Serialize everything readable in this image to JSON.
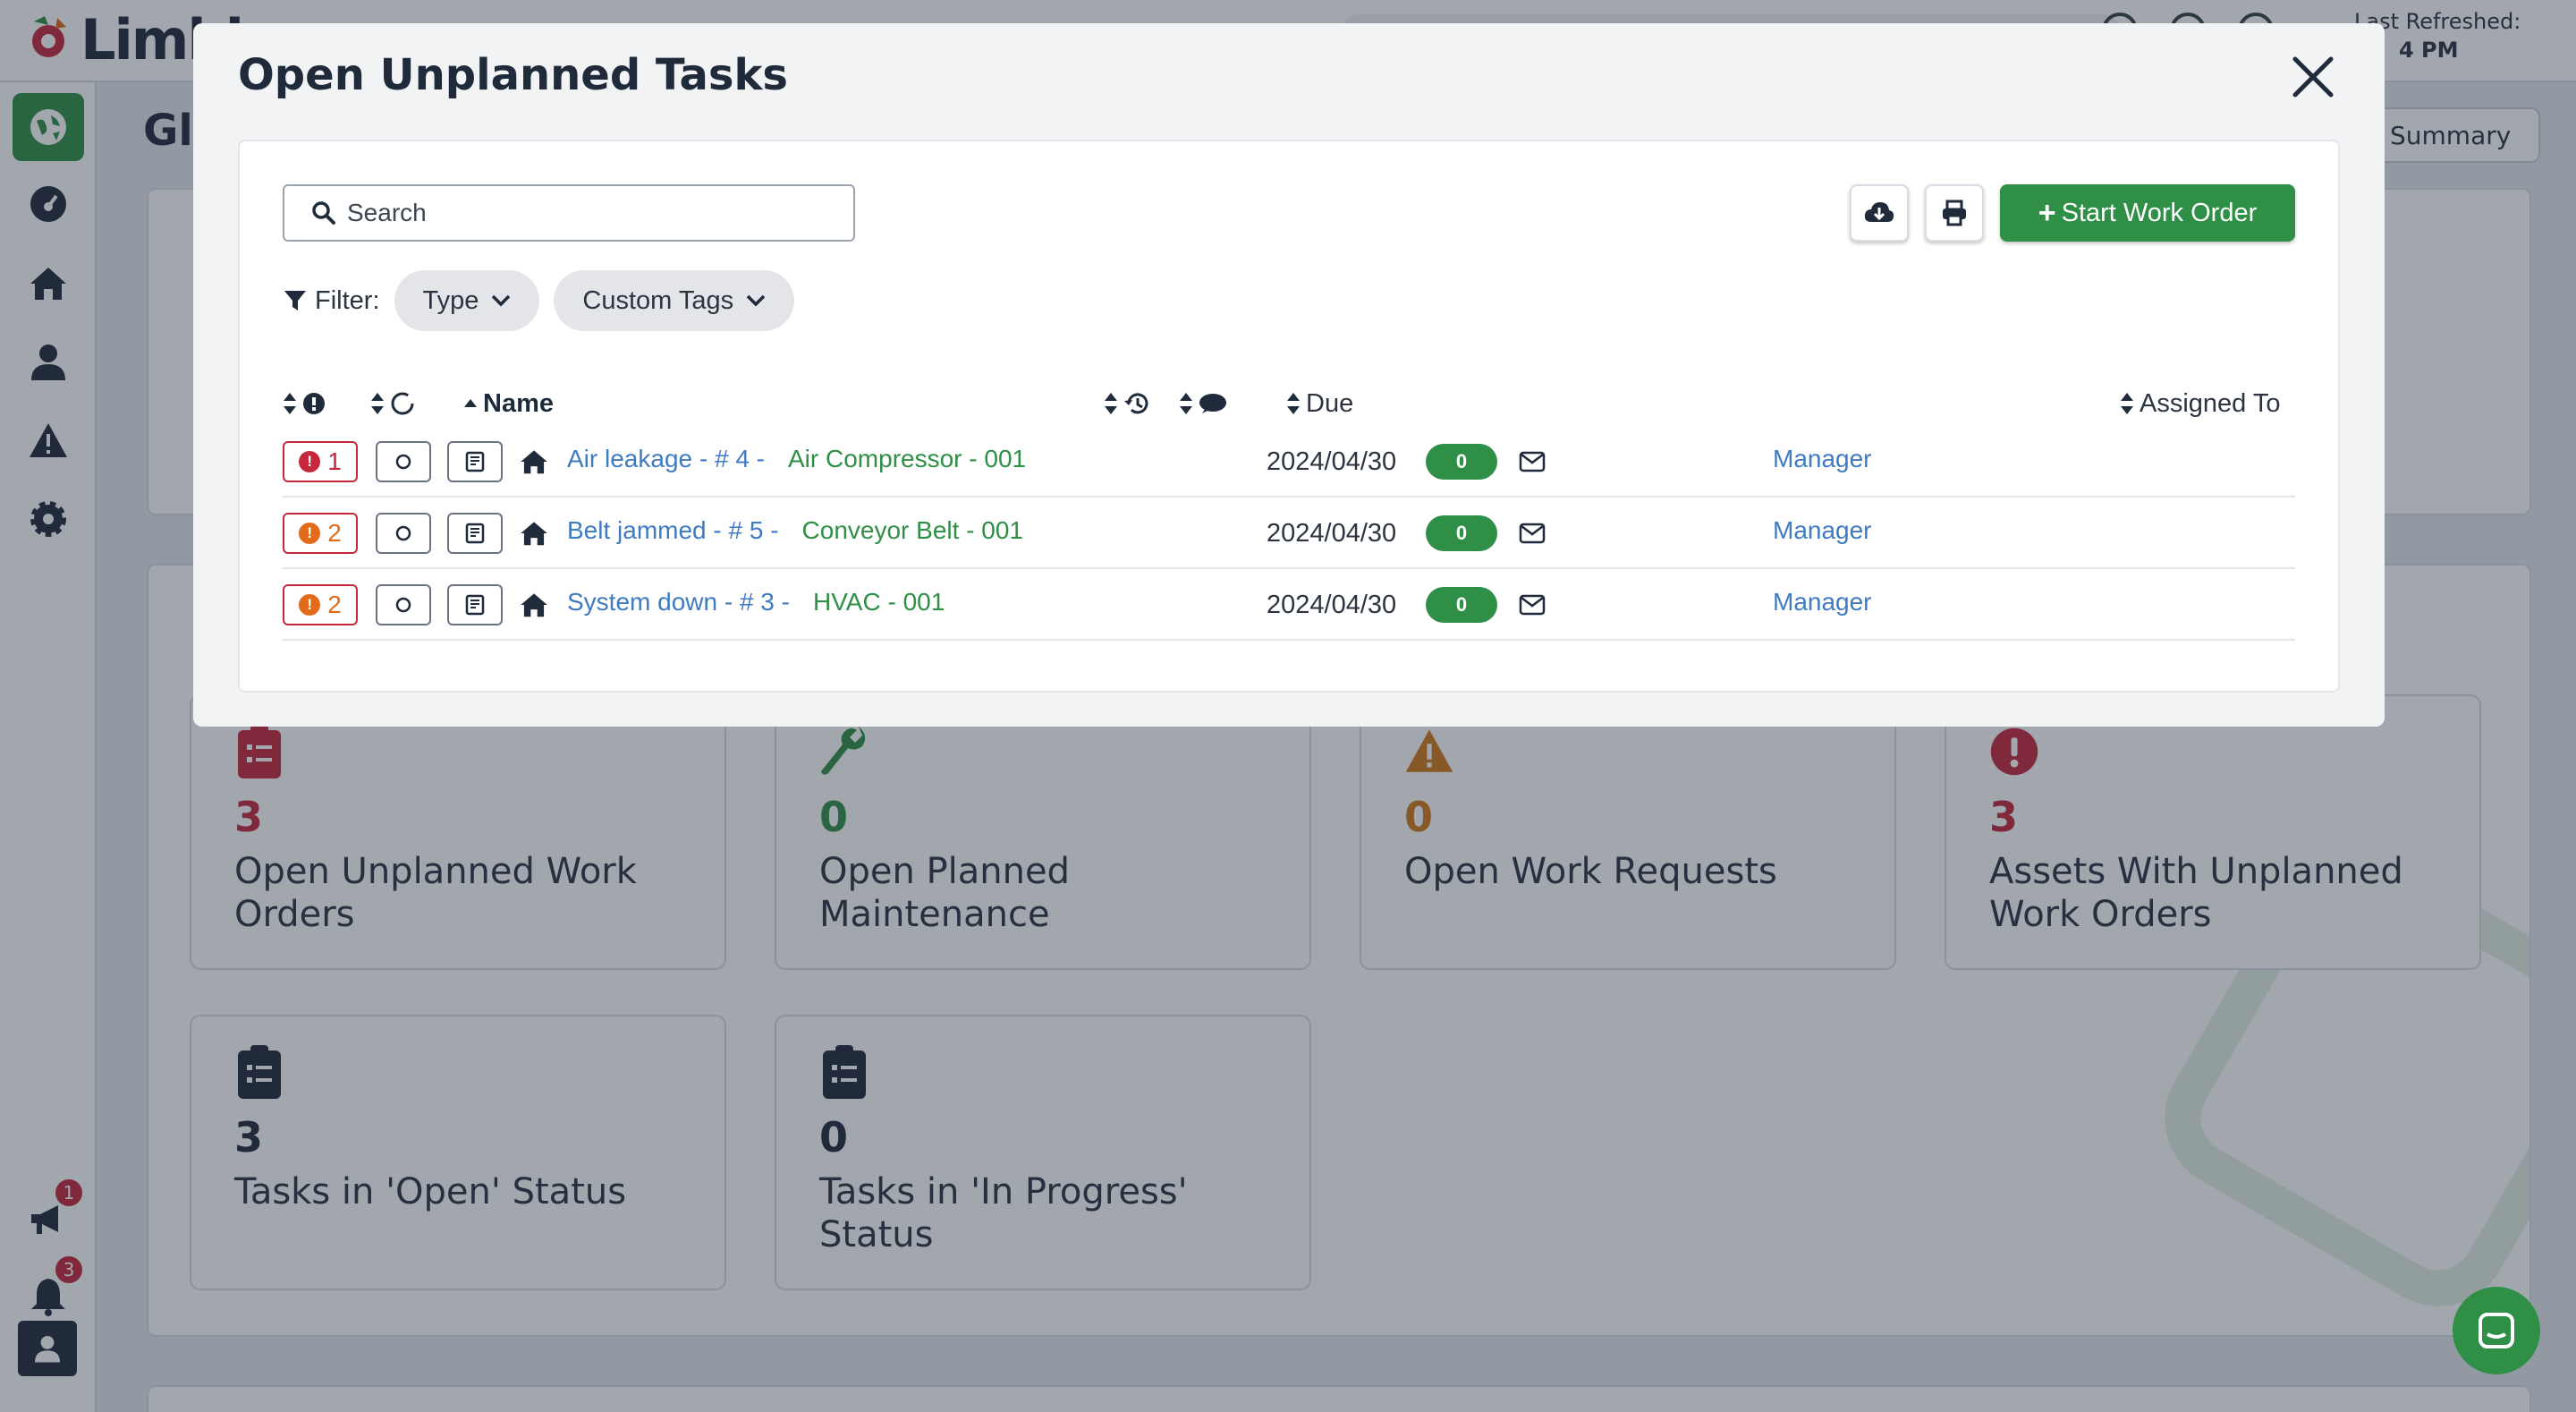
{
  "app": {
    "logo_text": "Limbl",
    "last_refreshed_label": "Last Refreshed:",
    "last_refreshed_time": "4 PM",
    "page_title": "Gl",
    "summary_button": "Summary"
  },
  "sidebar": {
    "items": [
      {
        "name": "globe-icon",
        "active": true
      },
      {
        "name": "dashboard-icon",
        "active": false
      },
      {
        "name": "home-icon",
        "active": false
      },
      {
        "name": "user-icon",
        "active": false
      },
      {
        "name": "warning-icon",
        "active": false
      },
      {
        "name": "gear-icon",
        "active": false
      },
      {
        "name": "megaphone-icon",
        "badge": "1"
      },
      {
        "name": "bell-icon",
        "badge": "3"
      }
    ],
    "megaphone_badge": "1",
    "bell_badge": "3"
  },
  "stats": [
    {
      "icon": "clipboard-list-icon",
      "value": "3",
      "label": "Open Unplanned Work Orders",
      "color": "#c5283d"
    },
    {
      "icon": "wrench-icon",
      "value": "0",
      "label": "Open Planned Maintenance",
      "color": "#2f8f46"
    },
    {
      "icon": "warning-triangle-icon",
      "value": "0",
      "label": "Open Work Requests",
      "color": "#d07a1a"
    },
    {
      "icon": "exclamation-circle-icon",
      "value": "3",
      "label": "Assets With Unplanned Work Orders",
      "color": "#c5283d"
    },
    {
      "icon": "clipboard-list-icon",
      "value": "3",
      "label": "Tasks in 'Open' Status",
      "color": "#1f2a3a"
    },
    {
      "icon": "clipboard-list-icon",
      "value": "0",
      "label": "Tasks in 'In Progress' Status",
      "color": "#1f2a3a"
    }
  ],
  "modal": {
    "title": "Open Unplanned Tasks",
    "search_placeholder": "Search",
    "start_work_order": "Start Work Order",
    "filter_label": "Filter:",
    "filter_type": "Type",
    "filter_custom_tags": "Custom Tags",
    "columns": {
      "name": "Name",
      "due": "Due",
      "assigned_to": "Assigned To"
    },
    "rows": [
      {
        "priority": "1",
        "priority_level": "critical",
        "task": "Air leakage - # 4 -",
        "asset": "Air Compressor - 001",
        "due": "2024/04/30",
        "comments": "0",
        "assignee": "Manager"
      },
      {
        "priority": "2",
        "priority_level": "high",
        "task": "Belt jammed - # 5 -",
        "asset": "Conveyor Belt - 001",
        "due": "2024/04/30",
        "comments": "0",
        "assignee": "Manager"
      },
      {
        "priority": "2",
        "priority_level": "high",
        "task": "System down - # 3 -",
        "asset": "HVAC - 001",
        "due": "2024/04/30",
        "comments": "0",
        "assignee": "Manager"
      }
    ]
  },
  "colors": {
    "brand_green": "#2f8f46",
    "link_blue": "#3f7bc0",
    "critical_red": "#c5283d",
    "high_orange": "#e26a1b"
  }
}
